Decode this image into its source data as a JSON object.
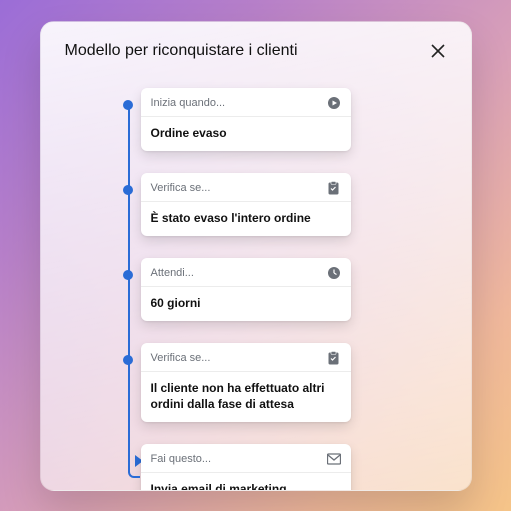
{
  "header": {
    "title": "Modello per riconquistare i clienti"
  },
  "steps": [
    {
      "type": "Inizia quando...",
      "label": "Ordine evaso",
      "icon": "play",
      "connector": "dot"
    },
    {
      "type": "Verifica se...",
      "label": "È stato evaso l'intero ordine",
      "icon": "clipboard",
      "connector": "dot"
    },
    {
      "type": "Attendi...",
      "label": "60 giorni",
      "icon": "clock",
      "connector": "dot"
    },
    {
      "type": "Verifica se...",
      "label": "Il cliente non ha effettuato altri ordini dalla fase di attesa",
      "icon": "clipboard",
      "connector": "dot"
    },
    {
      "type": "Fai questo...",
      "label": "Invia email di marketing",
      "icon": "mail",
      "connector": "arrow",
      "sparks": true
    }
  ]
}
